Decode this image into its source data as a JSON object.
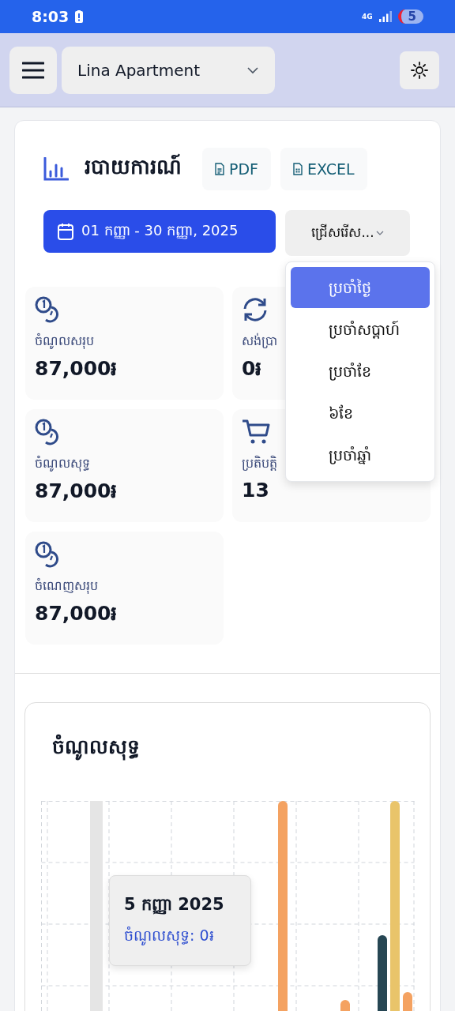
{
  "status_bar": {
    "time": "8:03",
    "network": "4G",
    "battery": "5"
  },
  "header": {
    "property": "Lina Apartment"
  },
  "report": {
    "title": "របាយការណ៍",
    "export_buttons": [
      {
        "label": "PDF",
        "kind": "pdf"
      },
      {
        "label": "EXCEL",
        "kind": "excel"
      }
    ],
    "date_range": "01 កញ្ញា - 30 កញ្ញា, 2025",
    "period_select": "ជ្រើសរើស...",
    "period_menu": [
      {
        "label": "ប្រចាំថ្ងៃ",
        "selected": true
      },
      {
        "label": "ប្រចាំសប្ដាហ៍",
        "selected": false
      },
      {
        "label": "ប្រចាំខែ",
        "selected": false
      },
      {
        "label": "៦ខែ",
        "selected": false
      },
      {
        "label": "ប្រចាំឆ្នាំ",
        "selected": false
      }
    ]
  },
  "stats": [
    {
      "kind": "coins",
      "label": "ចំណូលសរុប",
      "value": "87,000៛"
    },
    {
      "kind": "refresh",
      "label": "សង់ប្រា",
      "value": "0៛"
    },
    {
      "kind": "coins",
      "label": "ចំណូលសុទ្ធ",
      "value": "87,000៛"
    },
    {
      "kind": "cart",
      "label": "ប្រតិបត្តិ",
      "value": "13"
    },
    {
      "kind": "coins",
      "label": "ចំណេញសរុប",
      "value": "87,000៛"
    }
  ],
  "chart": {
    "title": "ចំណូលសុទ្ធ",
    "tooltip": {
      "date": "5 កញ្ញា 2025",
      "line": "ចំណូលសុទ្ធ: 0៛"
    }
  }
}
